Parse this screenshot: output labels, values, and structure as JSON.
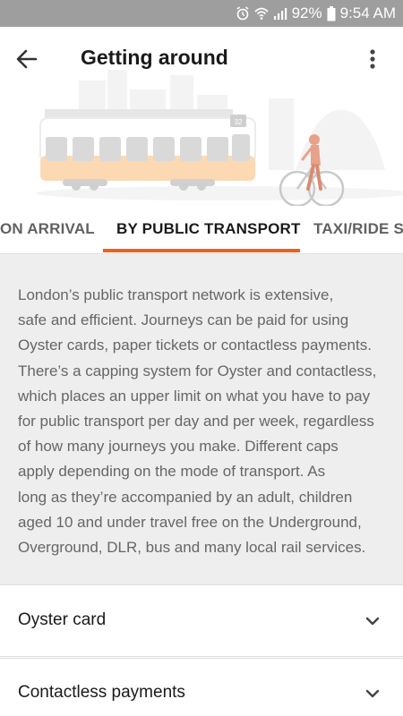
{
  "status_bar": {
    "battery": "92%",
    "time": "9:54 AM",
    "icons": [
      "alarm-icon",
      "wifi-icon",
      "signal-icon",
      "battery-icon"
    ]
  },
  "app_bar": {
    "title": "Getting around",
    "icons": [
      "back-arrow-icon",
      "more-vert-icon"
    ]
  },
  "hero": {
    "tram_number": "32",
    "colors": {
      "tram_body": "#fcd9b3",
      "tram_top": "#ffffff",
      "windows": "#d9d9d9",
      "cyclist": "#e8a28a"
    }
  },
  "tabs": [
    {
      "label": "ON ARRIVAL",
      "active": false
    },
    {
      "label": "BY PUBLIC TRANSPORT",
      "active": true
    },
    {
      "label": "TAXI/RIDE SH",
      "active": false
    }
  ],
  "accent_color": "#e8641e",
  "body": {
    "lines": [
      "London’s public transport network is extensive,",
      "safe and efficient. Journeys can be paid for using",
      "Oyster cards, paper tickets or contactless payments.",
      "There’s a capping system for Oyster and contactless,",
      "which places an upper limit on what you have to pay",
      "for public transport per day and per week, regardless",
      "of how many journeys you make. Different caps",
      "apply depending on the mode of transport. As",
      "long as they’re accompanied by an adult, children",
      "aged 10 and under travel free on the Underground,",
      "Overground, DLR, bus and many local rail services."
    ]
  },
  "accordion": [
    {
      "label": "Oyster card",
      "icon": "chevron-down-icon"
    },
    {
      "label": "Contactless payments",
      "icon": "chevron-down-icon"
    }
  ]
}
